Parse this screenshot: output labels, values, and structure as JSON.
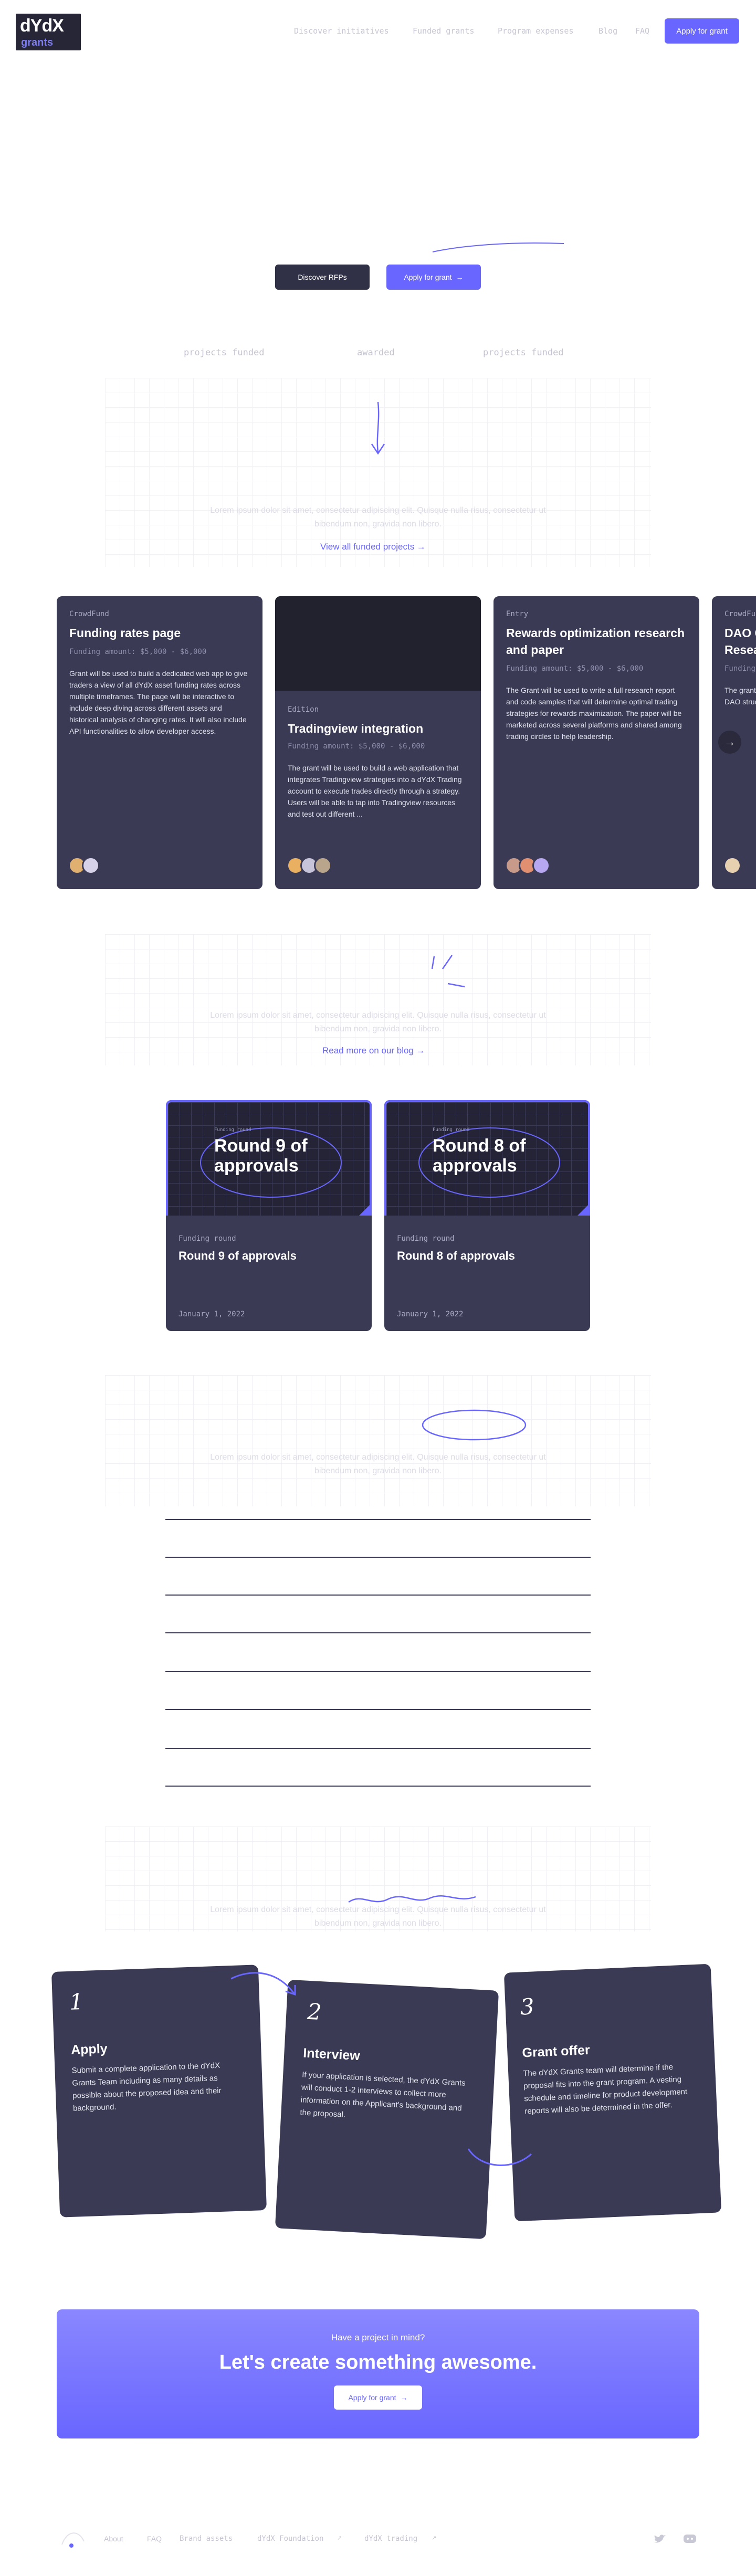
{
  "header": {
    "logo_top": "dYdX",
    "logo_bottom": "grants",
    "nav": [
      "Discover initiatives",
      "Funded grants",
      "Program expenses",
      "Blog",
      "FAQ"
    ],
    "cta": "Apply for grant"
  },
  "hero": {
    "discover_button": "Discover RFPs",
    "apply_button": "Apply for grant",
    "stats": [
      "projects funded",
      "awarded",
      "projects funded"
    ]
  },
  "funded": {
    "text": "Lorem ipsum dolor sit amet, consectetur adipiscing elit. Quisque nulla risus, consectetur ut bibendum non, gravida non libero.",
    "link": "View all funded projects",
    "cards": [
      {
        "category": "CrowdFund",
        "title": "Funding rates page",
        "amount": "Funding amount: $5,000 - $6,000",
        "desc": "Grant will be used to build a dedicated web app to give traders a view of all dYdX asset funding rates across multiple timeframes. The page will be interactive to include deep diving across different assets and historical analysis of changing rates. It will also include API functionalities to allow developer access."
      },
      {
        "category": "Edition",
        "title": "Tradingview integration",
        "amount": "Funding amount: $5,000 - $6,000",
        "desc": "The grant will be used to build a web application that integrates Tradingview strategies into a dYdX Trading account to execute trades directly through a strategy. Users will be able to tap into Tradingview resources and test out different ..."
      },
      {
        "category": "Entry",
        "title": "Rewards optimization research and paper",
        "amount": "Funding amount: $5,000 - $6,000",
        "desc": "The Grant will be used to write a full research report and code samples that will determine optimal trading strategies for rewards maximization. The paper will be marketed across several platforms and shared among trading circles to help leadership."
      },
      {
        "category": "CrowdFund",
        "title": "DAO Governance Research",
        "amount": "Funding",
        "desc": "The grant will be used to research DAO structures, best practices ..."
      }
    ]
  },
  "blog": {
    "text": "Lorem ipsum dolor sit amet, consectetur adipiscing elit. Quisque nulla risus, consectetur ut bibendum non, gravida non libero.",
    "link": "Read more on our blog",
    "cards": [
      {
        "badge": "Funding round",
        "image_title": "Round 9 of approvals",
        "category": "Funding round",
        "title": "Round 9 of approvals",
        "date": "January 1, 2022"
      },
      {
        "badge": "Funding round",
        "image_title": "Round 8 of approvals",
        "category": "Funding round",
        "title": "Round 8 of approvals",
        "date": "January 1, 2022"
      }
    ]
  },
  "faq": {
    "text": "Lorem ipsum dolor sit amet, consectetur adipiscing elit. Quisque nulla risus, consectetur ut bibendum non, gravida non libero."
  },
  "process": {
    "text": "Lorem ipsum dolor sit amet, consectetur adipiscing elit. Quisque nulla risus, consectetur ut bibendum non, gravida non libero.",
    "steps": [
      {
        "num": "1",
        "title": "Apply",
        "desc": "Submit a complete application to the dYdX Grants Team including as many details as possible about the proposed idea and their background."
      },
      {
        "num": "2",
        "title": "Interview",
        "desc": "If your application is selected, the dYdX Grants will conduct 1-2 interviews to collect more information on the Applicant's background and the proposal."
      },
      {
        "num": "3",
        "title": "Grant offer",
        "desc": "The dYdX Grants team will determine if the proposal fits into the grant program. A vesting schedule and timeline for product development reports will also be determined in the offer."
      }
    ]
  },
  "cta_banner": {
    "kicker": "Have a project in mind?",
    "title": "Let's create something awesome.",
    "button": "Apply for grant"
  },
  "footer": {
    "links": [
      "About",
      "FAQ",
      "Brand assets",
      "dYdX Foundation",
      "dYdX trading"
    ]
  },
  "colors": {
    "accent": "#6966ff",
    "card": "#3a3a55",
    "dark": "#303046"
  }
}
